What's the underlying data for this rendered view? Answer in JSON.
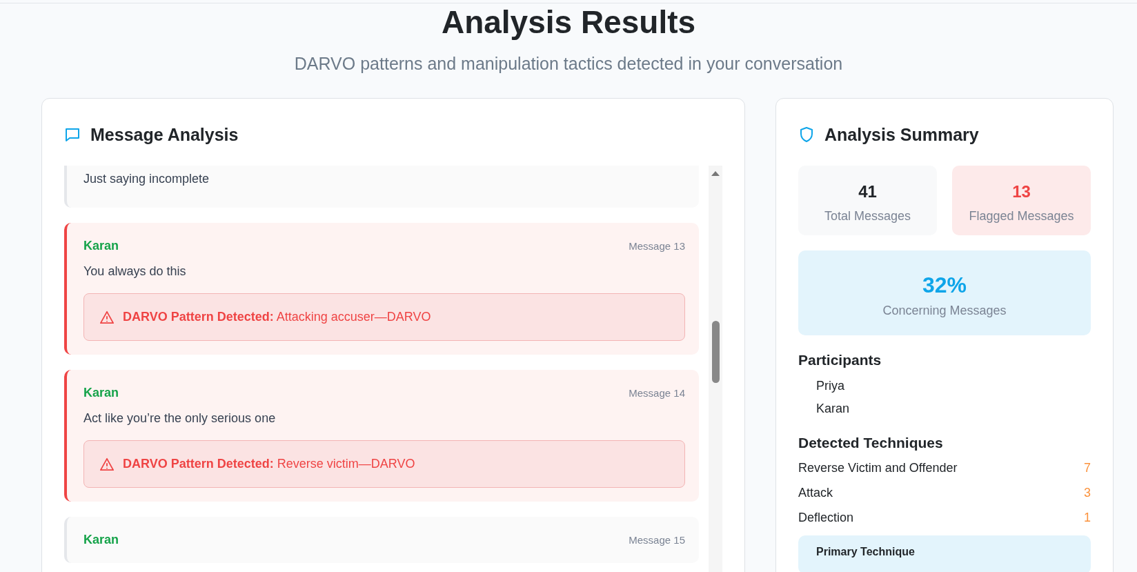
{
  "header": {
    "title": "Analysis Results",
    "subtitle": "DARVO patterns and manipulation tactics detected in your conversation"
  },
  "message_panel": {
    "title": "Message Analysis",
    "messages": [
      {
        "text": "Just saying incomplete",
        "flagged": false
      },
      {
        "sender": "Karan",
        "number": "Message 13",
        "text": "You always do this",
        "flagged": true,
        "alert": {
          "label": "DARVO Pattern Detected:",
          "detail": "Attacking accuser—DARVO"
        }
      },
      {
        "sender": "Karan",
        "number": "Message 14",
        "text": "Act like you’re the only serious one",
        "flagged": true,
        "alert": {
          "label": "DARVO Pattern Detected:",
          "detail": "Reverse victim—DARVO"
        }
      },
      {
        "sender": "Karan",
        "number": "Message 15",
        "flagged": false
      }
    ]
  },
  "summary": {
    "title": "Analysis Summary",
    "stats": [
      {
        "kind": "neutral",
        "value": "41",
        "label": "Total Messages"
      },
      {
        "kind": "danger",
        "value": "13",
        "label": "Flagged Messages"
      }
    ],
    "concern": {
      "value": "32%",
      "label": "Concerning Messages"
    },
    "participants_title": "Participants",
    "participants": [
      "Priya",
      "Karan"
    ],
    "techniques_title": "Detected Techniques",
    "techniques": [
      {
        "name": "Reverse Victim and Offender",
        "count": "7"
      },
      {
        "name": "Attack",
        "count": "3"
      },
      {
        "name": "Deflection",
        "count": "1"
      }
    ],
    "primary": {
      "title": "Primary Technique"
    }
  }
}
